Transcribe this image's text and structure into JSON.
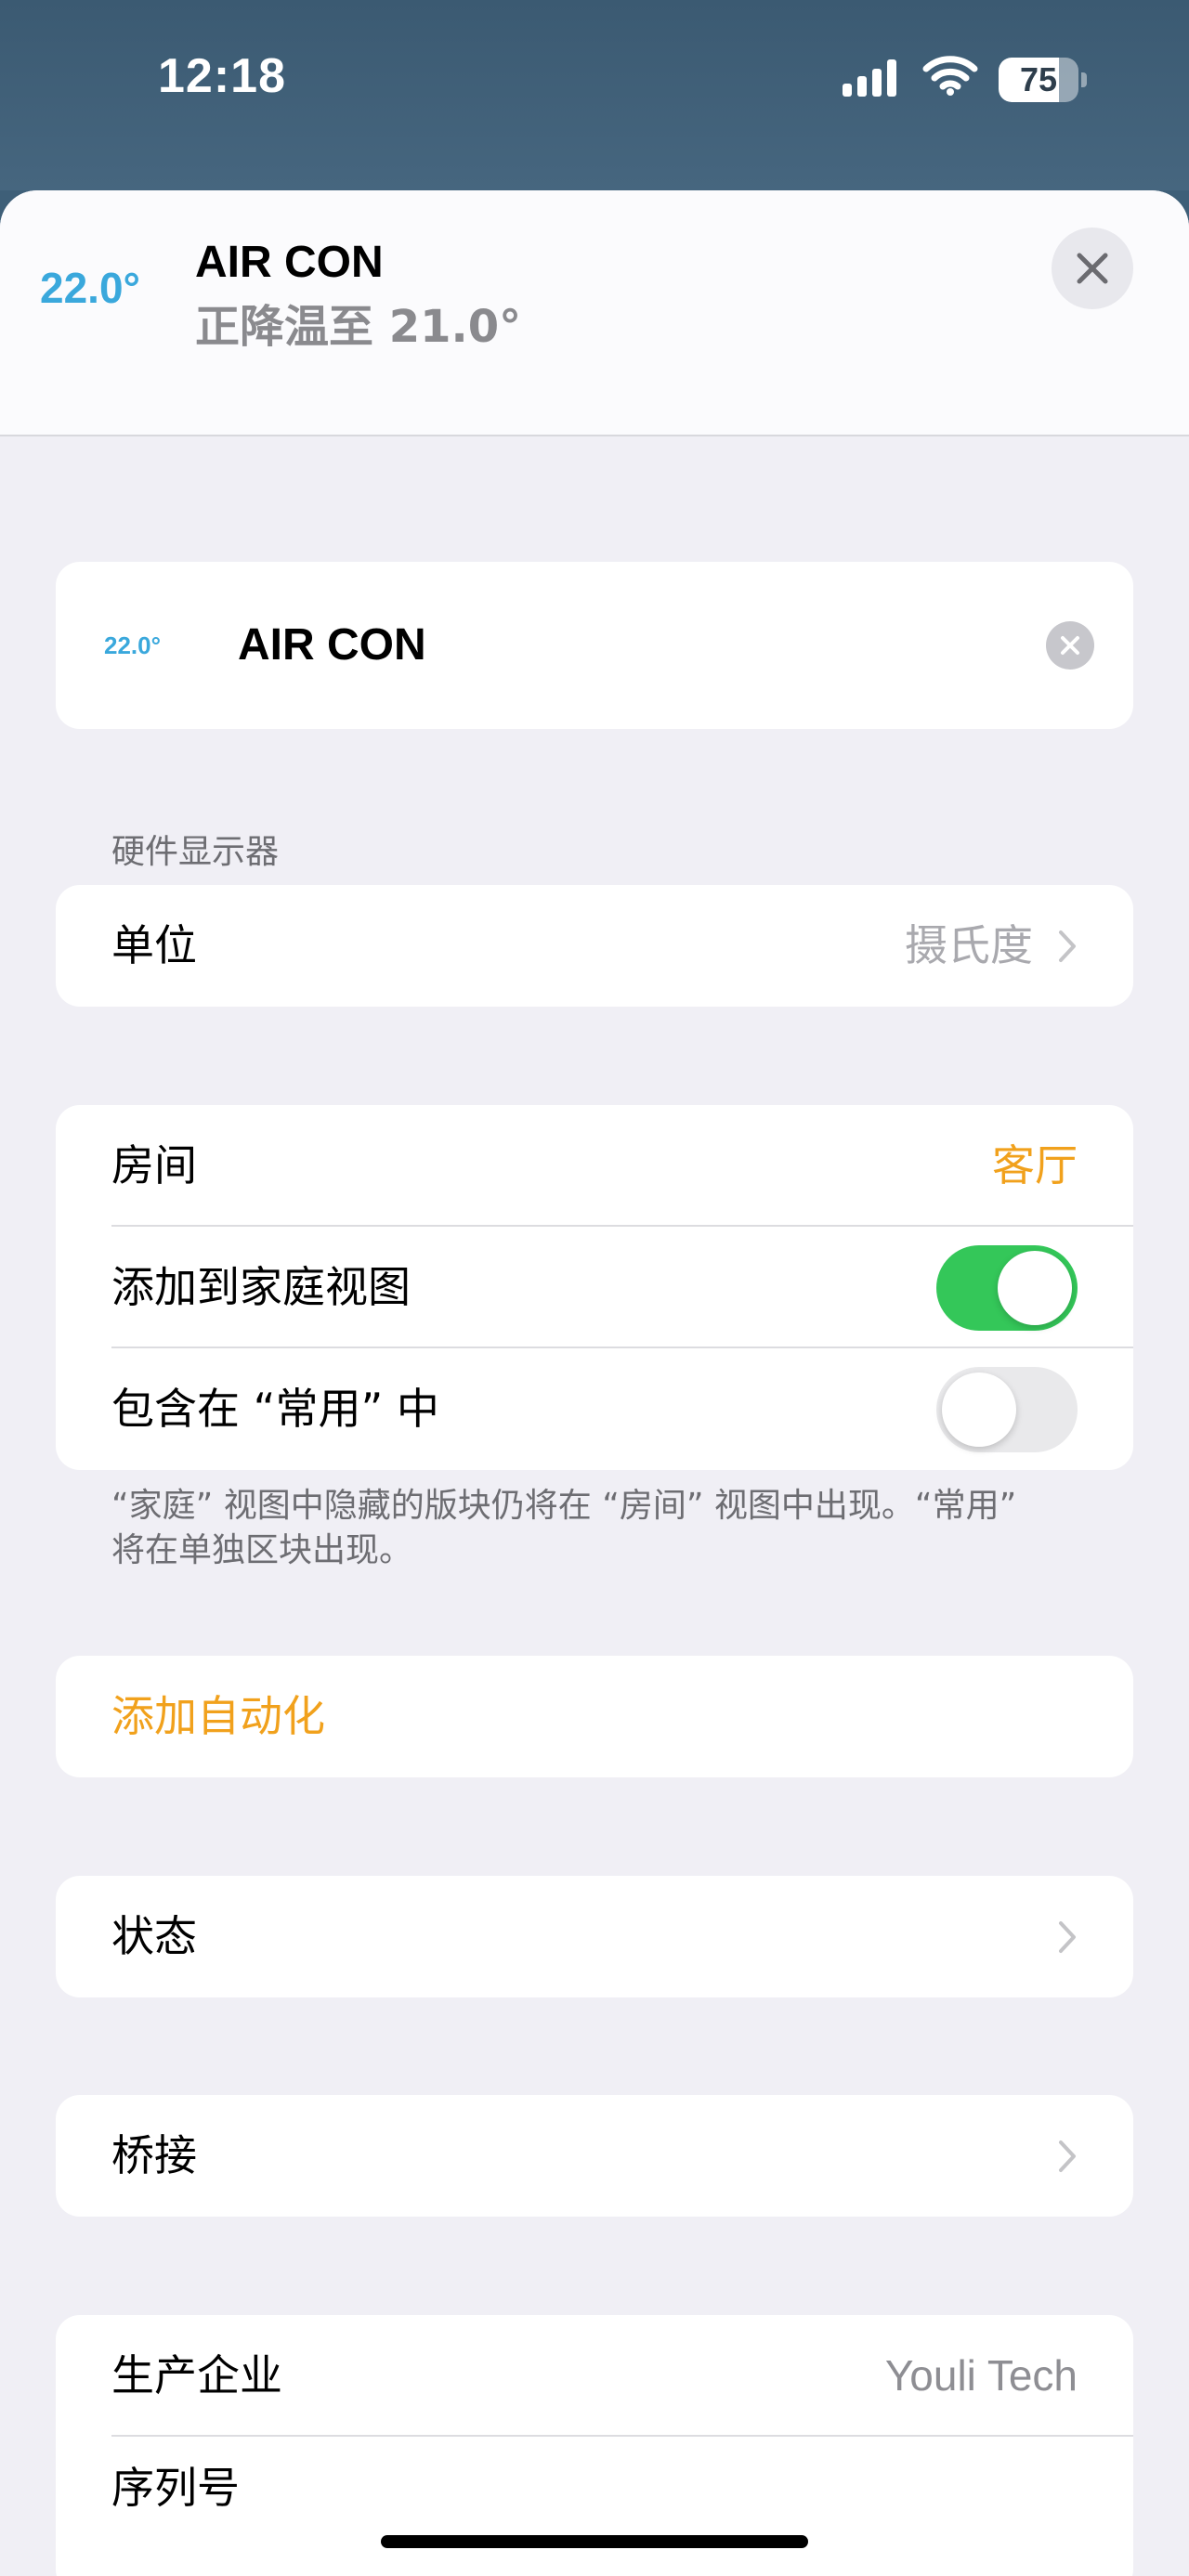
{
  "status_bar": {
    "time": "12:18",
    "battery": "75",
    "battery_level": 0.75
  },
  "header": {
    "current_temp": "22.0°",
    "title": "AIR CON",
    "subtitle": "正降温至 21.0°"
  },
  "name_card": {
    "temp": "22.0°",
    "name_value": "AIR CON"
  },
  "hardware": {
    "section_title": "硬件显示器",
    "unit_label": "单位",
    "unit_value": "摄氏度"
  },
  "room_settings": {
    "room_label": "房间",
    "room_value": "客厅",
    "add_home_view_label": "添加到家庭视图",
    "add_home_view_on": true,
    "include_favorites_label": "包含在 “常用” 中",
    "include_favorites_on": false,
    "footnote_line1": "“家庭” 视图中隐藏的版块仍将在 “房间” 视图中出现。“常用”",
    "footnote_line2": "将在单独区块出现。"
  },
  "automation": {
    "add_label": "添加自动化"
  },
  "status_row": {
    "label": "状态"
  },
  "bridge_row": {
    "label": "桥接"
  },
  "info": {
    "manufacturer_label": "生产企业",
    "manufacturer_value": "Youli Tech",
    "serial_label": "序列号"
  },
  "colors": {
    "accent": "#f1a11c",
    "temp_blue": "#3aa8dc",
    "toggle_on": "#34c759",
    "background": "#f0eff5"
  }
}
